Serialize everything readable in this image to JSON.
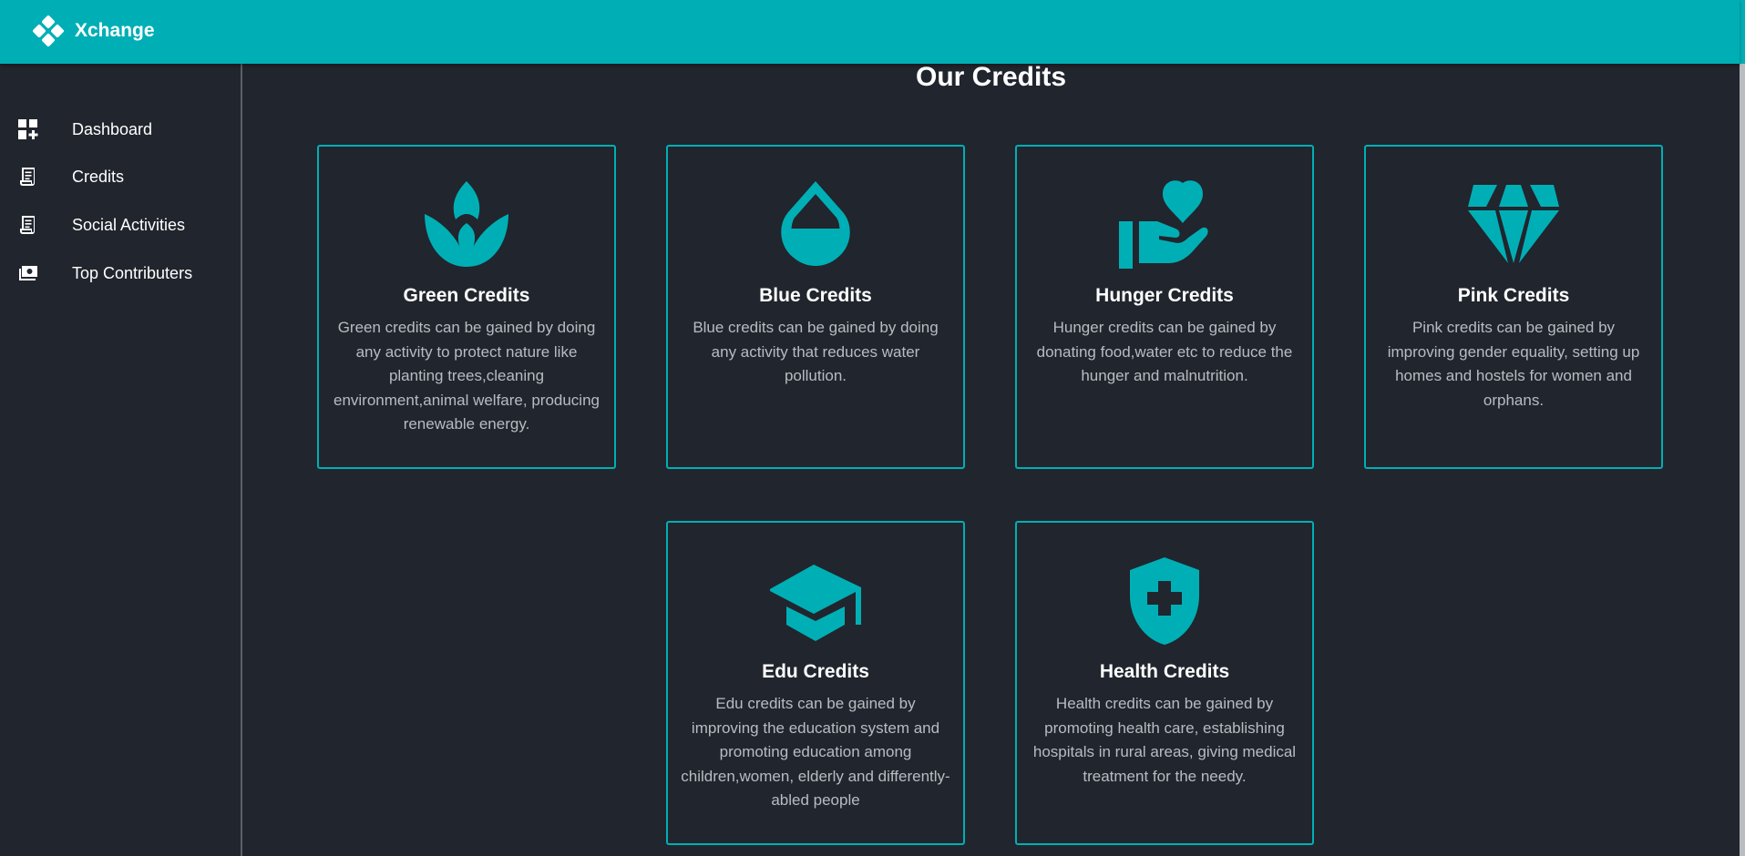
{
  "app": {
    "brand": "Xchange",
    "accent": "#00afb5",
    "background": "#21252d"
  },
  "sidebar": {
    "items": [
      {
        "label": "Dashboard",
        "icon": "dashboard-add-icon"
      },
      {
        "label": "Credits",
        "icon": "receipt-icon"
      },
      {
        "label": "Social Activities",
        "icon": "receipt-icon"
      },
      {
        "label": "Top Contributers",
        "icon": "money-icon"
      }
    ]
  },
  "main": {
    "title": "Our Credits",
    "cards": [
      {
        "title": "Green Credits",
        "icon": "spa-leaf-icon",
        "text": "Green credits can be gained by doing any activity to protect nature like planting trees,cleaning environment,animal welfare, producing renewable energy."
      },
      {
        "title": "Blue Credits",
        "icon": "water-drop-icon",
        "text": "Blue credits can be gained by doing any activity that reduces water pollution."
      },
      {
        "title": "Hunger Credits",
        "icon": "volunteer-hand-heart-icon",
        "text": "Hunger credits can be gained by donating food,water etc to reduce the hunger and malnutrition."
      },
      {
        "title": "Pink Credits",
        "icon": "diamond-icon",
        "text": "Pink credits can be gained by improving gender equality, setting up homes and hostels for women and orphans."
      },
      {
        "title": "Edu Credits",
        "icon": "graduation-cap-icon",
        "text": "Edu credits can be gained by improving the education system and promoting education among children,women, elderly and differently-abled people"
      },
      {
        "title": "Health Credits",
        "icon": "shield-cross-icon",
        "text": "Health credits can be gained by promoting health care, establishing hospitals in rural areas, giving medical treatment for the needy."
      }
    ]
  }
}
